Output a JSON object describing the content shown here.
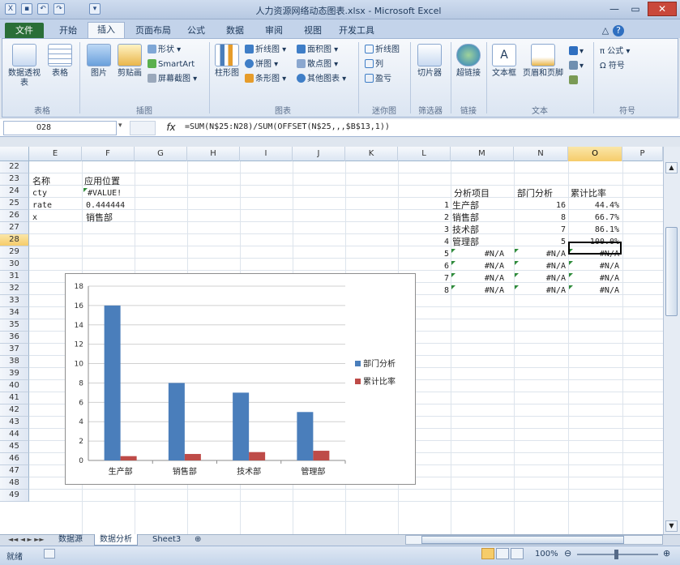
{
  "window": {
    "title": "人力资源网络动态图表.xlsx - Microsoft Excel"
  },
  "tabs": {
    "file": "文件",
    "items": [
      "开始",
      "插入",
      "页面布局",
      "公式",
      "数据",
      "审阅",
      "视图",
      "开发工具"
    ]
  },
  "ribbon": {
    "groups": [
      "表格",
      "插图",
      "图表",
      "迷你图",
      "筛选器",
      "链接",
      "文本",
      "符号"
    ],
    "table_buttons": [
      "数据透视表",
      "表格"
    ],
    "illus_buttons": [
      "图片",
      "剪贴画"
    ],
    "illus_small": [
      "形状",
      "SmartArt",
      "屏幕截图"
    ],
    "chart_big": "柱形图",
    "chart_small": [
      "折线图",
      "饼图",
      "条形图",
      "面积图",
      "散点图",
      "其他图表"
    ],
    "spark_small": [
      "折线图",
      "列",
      "盈亏"
    ],
    "slicer": "切片器",
    "hyperlink": "超链接",
    "text_buttons": [
      "文本框",
      "页眉和页脚"
    ],
    "symbol_small": [
      "公式",
      "符号"
    ]
  },
  "formula_bar": {
    "name_box": "O28",
    "fx": "fx",
    "formula": "=SUM(N$25:N28)/SUM(OFFSET(N$25,,,$B$13,1))"
  },
  "sheet": {
    "columns": [
      "E",
      "F",
      "G",
      "H",
      "I",
      "J",
      "K",
      "L",
      "M",
      "N",
      "O",
      "P"
    ],
    "rows": [
      "22",
      "23",
      "24",
      "25",
      "26",
      "27",
      "28",
      "29",
      "30",
      "31",
      "32",
      "33",
      "34",
      "35",
      "36",
      "37",
      "38",
      "39",
      "40",
      "41",
      "42",
      "43",
      "44",
      "45",
      "46",
      "47",
      "48",
      "49"
    ],
    "left_table": {
      "header": [
        "名称",
        "应用位置"
      ],
      "rows": [
        [
          "cty",
          "#VALUE!"
        ],
        [
          "rate",
          "0.444444"
        ],
        [
          "x",
          "销售部"
        ]
      ]
    },
    "right_table": {
      "header": [
        "分析项目",
        "部门分析",
        "累计比率"
      ],
      "rows": [
        [
          "1",
          "生产部",
          "16",
          "44.4%"
        ],
        [
          "2",
          "销售部",
          "8",
          "66.7%"
        ],
        [
          "3",
          "技术部",
          "7",
          "86.1%"
        ],
        [
          "4",
          "管理部",
          "5",
          "100.0%"
        ],
        [
          "5",
          "#N/A",
          "#N/A",
          "#N/A"
        ],
        [
          "6",
          "#N/A",
          "#N/A",
          "#N/A"
        ],
        [
          "7",
          "#N/A",
          "#N/A",
          "#N/A"
        ],
        [
          "8",
          "#N/A",
          "#N/A",
          "#N/A"
        ]
      ]
    }
  },
  "chart_data": {
    "type": "bar",
    "categories": [
      "生产部",
      "销售部",
      "技术部",
      "管理部"
    ],
    "series": [
      {
        "name": "部门分析",
        "values": [
          16,
          8,
          7,
          5
        ],
        "color": "#4a7ebb"
      },
      {
        "name": "累计比率",
        "values": [
          0.444,
          0.667,
          0.861,
          1.0
        ],
        "color": "#be4b48"
      }
    ],
    "ylim": [
      0,
      18
    ],
    "yticks": [
      "0",
      "2",
      "4",
      "6",
      "8",
      "10",
      "12",
      "14",
      "16",
      "18"
    ],
    "grid": true,
    "legend": "right"
  },
  "sheet_tabs": [
    "数据源",
    "数据分析",
    "Sheet3"
  ],
  "status": {
    "ready": "就绪",
    "zoom": "100%"
  },
  "colors": {
    "accent": "#2a6e37",
    "selection": "#f6cc6a"
  }
}
